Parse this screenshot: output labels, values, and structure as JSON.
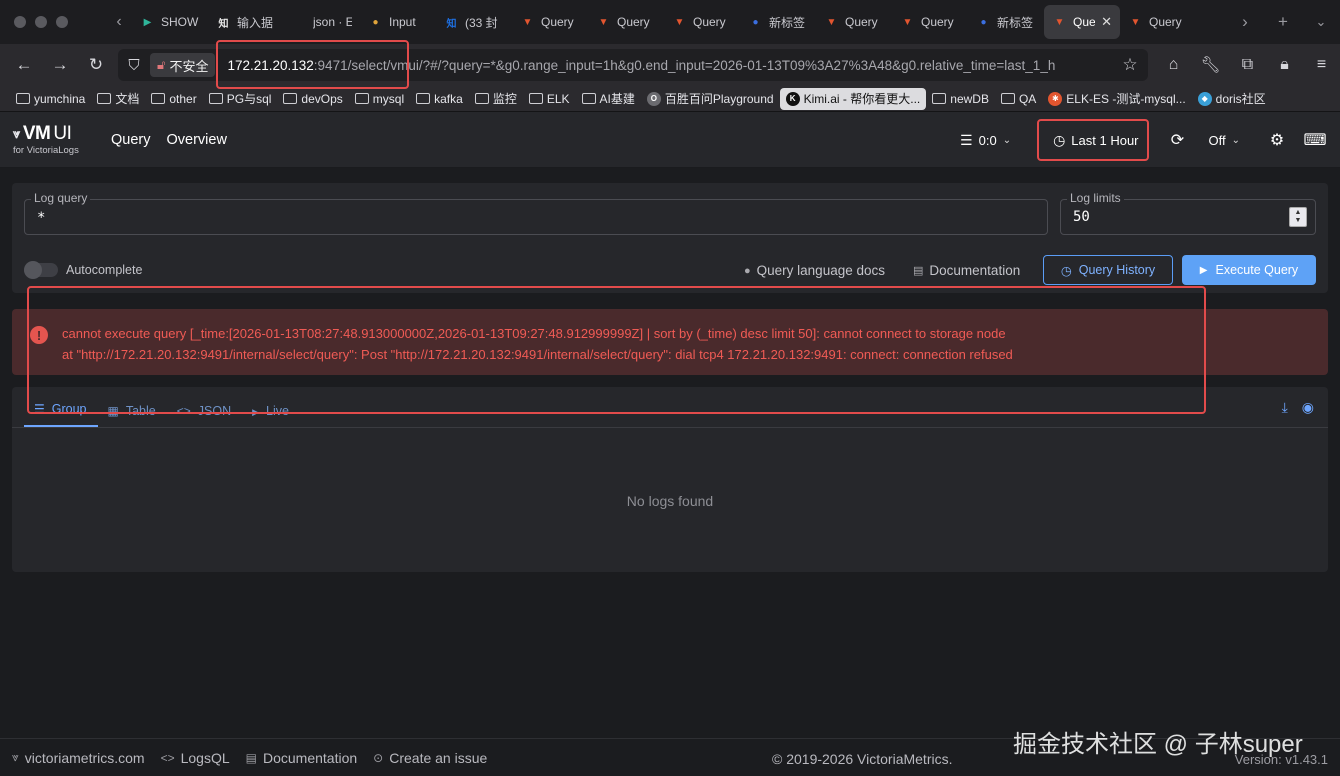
{
  "browser": {
    "tabs": [
      {
        "label": "SHOW",
        "fav_color": "#2fb59a",
        "fav_glyph": "▶",
        "fav_icon": "play-icon"
      },
      {
        "label": "输入据",
        "fav_color": "#e8e8e8",
        "fav_glyph": "知",
        "fav_icon": "dict-icon"
      },
      {
        "label": "json · ELK",
        "fav_color": "#1d1d20",
        "fav_glyph": "",
        "fav_icon": "blank-icon"
      },
      {
        "label": "Input",
        "fav_color": "#e0a43b",
        "fav_glyph": "●",
        "fav_icon": "globe-icon"
      },
      {
        "label": "(33 封",
        "fav_color": "#1e6fe0",
        "fav_glyph": "知",
        "fav_icon": "zhihu-icon"
      },
      {
        "label": "Query",
        "fav_color": "#e2552f",
        "fav_glyph": "▼",
        "fav_icon": "victorialogs-icon"
      },
      {
        "label": "Query",
        "fav_color": "#e2552f",
        "fav_glyph": "▼",
        "fav_icon": "victorialogs-icon"
      },
      {
        "label": "Query",
        "fav_color": "#e2552f",
        "fav_glyph": "▼",
        "fav_icon": "victorialogs-icon"
      },
      {
        "label": "新标签",
        "fav_color": "#3b6fe0",
        "fav_glyph": "●",
        "fav_icon": "firefox-icon"
      },
      {
        "label": "Query",
        "fav_color": "#e2552f",
        "fav_glyph": "▼",
        "fav_icon": "victorialogs-icon"
      },
      {
        "label": "Query",
        "fav_color": "#e2552f",
        "fav_glyph": "▼",
        "fav_icon": "victorialogs-icon"
      },
      {
        "label": "新标签",
        "fav_color": "#3b6fe0",
        "fav_glyph": "●",
        "fav_icon": "firefox-icon"
      },
      {
        "label": "Que",
        "fav_color": "#e2552f",
        "fav_glyph": "▼",
        "fav_icon": "victorialogs-icon",
        "active": true
      },
      {
        "label": "Query",
        "fav_color": "#e2552f",
        "fav_glyph": "▼",
        "fav_icon": "victorialogs-icon"
      }
    ],
    "insecure_label": "不安全",
    "url_host": "172.21.20.132",
    "url_rest": ":9471/select/vmui/?#/?query=*&g0.range_input=1h&g0.end_input=2026-01-13T09%3A27%3A48&g0.relative_time=last_1_h",
    "bookmarks": [
      {
        "label": "yumchina",
        "type": "folder"
      },
      {
        "label": "文档",
        "type": "folder"
      },
      {
        "label": "other",
        "type": "folder"
      },
      {
        "label": "PG与sql",
        "type": "folder"
      },
      {
        "label": "devOps",
        "type": "folder"
      },
      {
        "label": "mysql",
        "type": "folder"
      },
      {
        "label": "kafka",
        "type": "folder"
      },
      {
        "label": "监控",
        "type": "folder"
      },
      {
        "label": "ELK",
        "type": "folder"
      },
      {
        "label": "AI基建",
        "type": "folder"
      },
      {
        "label": "百胜百问Playground",
        "type": "site",
        "color": "#6b6b70",
        "glyph": "O"
      },
      {
        "label": "Kimi.ai - 帮你看更大...",
        "type": "site",
        "color": "#111111",
        "glyph": "K",
        "highlight": true
      },
      {
        "label": "newDB",
        "type": "folder"
      },
      {
        "label": "QA",
        "type": "folder"
      },
      {
        "label": "ELK-ES -测试-mysql...",
        "type": "site",
        "color": "#e2552f",
        "glyph": "✱"
      },
      {
        "label": "doris社区",
        "type": "site",
        "color": "#3aa0d8",
        "glyph": "◆"
      }
    ]
  },
  "vmui": {
    "logo_main": "VM",
    "logo_ui": "UI",
    "logo_sub": "for VictoriaLogs",
    "nav": {
      "query": "Query",
      "overview": "Overview"
    },
    "tenant": "0:0",
    "time_range": "Last 1 Hour",
    "refresh": "Off"
  },
  "query": {
    "log_query_label": "Log query",
    "log_query_value": "*",
    "log_limits_label": "Log limits",
    "log_limits_value": "50",
    "autocomplete_label": "Autocomplete",
    "docs_link": "Query language docs",
    "documentation_link": "Documentation",
    "history_button": "Query History",
    "execute_button": "Execute Query"
  },
  "error": {
    "line1": "cannot execute query [_time:[2026-01-13T08:27:48.913000000Z,2026-01-13T09:27:48.912999999Z] | sort by (_time) desc limit 50]: cannot connect to storage node",
    "line2": "at \"http://172.21.20.132:9491/internal/select/query\": Post \"http://172.21.20.132:9491/internal/select/query\": dial tcp4 172.21.20.132:9491: connect: connection refused"
  },
  "results": {
    "tabs": [
      "Group",
      "Table",
      "JSON",
      "Live"
    ],
    "empty": "No logs found"
  },
  "footer": {
    "site": "victoriametrics.com",
    "logsql": "LogsQL",
    "documentation": "Documentation",
    "issue": "Create an issue",
    "copyright": "© 2019-2026 VictoriaMetrics.",
    "version": "Version: v1.43.1"
  },
  "watermark": "掘金技术社区 @ 子林super",
  "colors": {
    "accent": "#5ea2f6",
    "error_text": "#f05b55",
    "error_bg": "#4a2a2c",
    "annotation": "#e24b4b"
  }
}
